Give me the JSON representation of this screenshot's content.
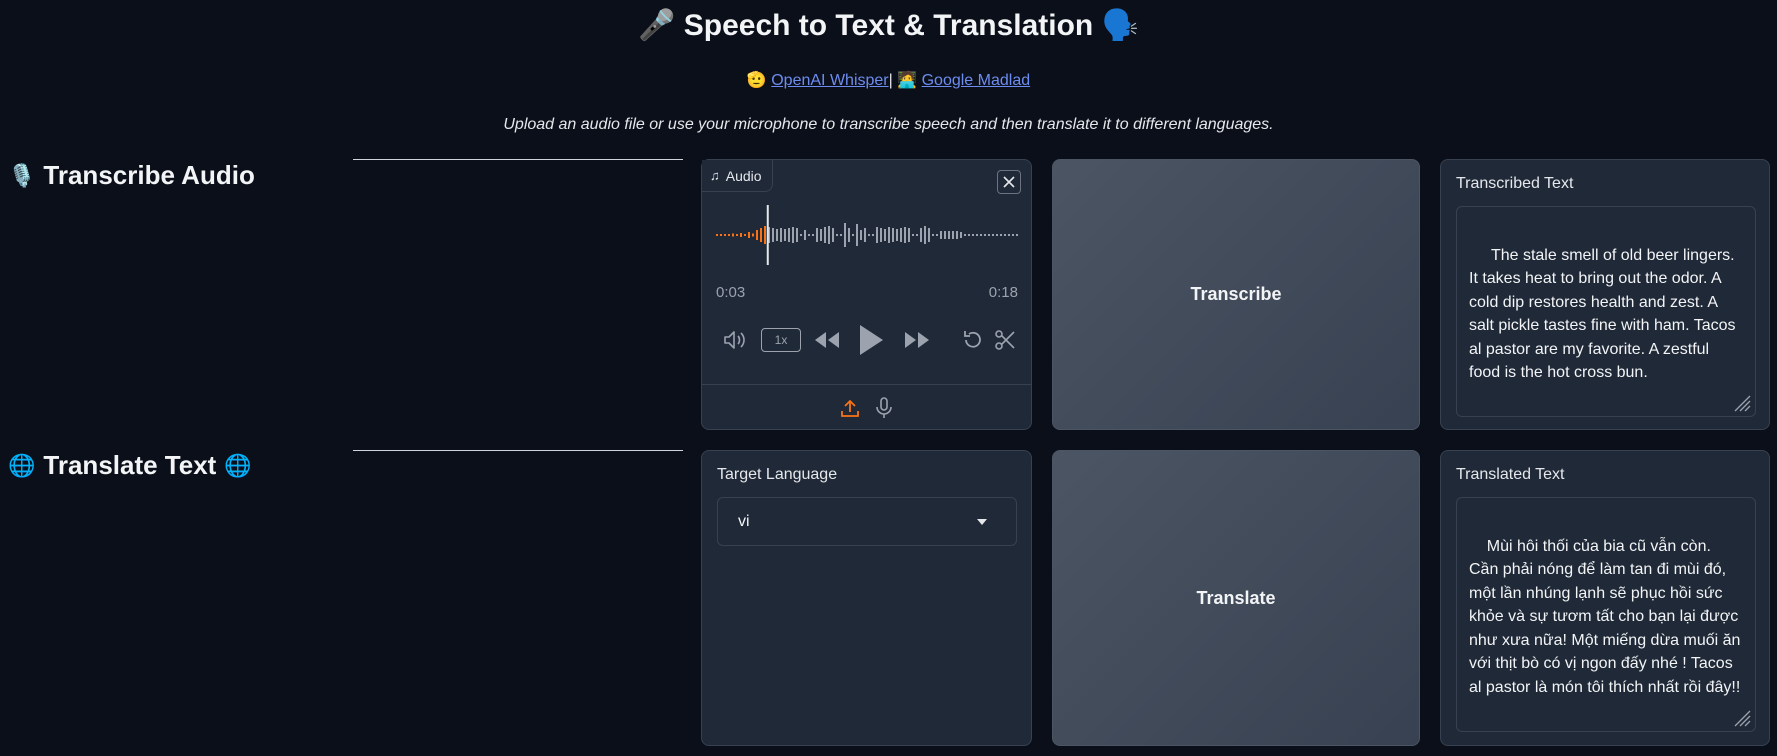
{
  "header": {
    "title": "Speech to Text & Translation",
    "title_icon_left": "microphone-icon",
    "title_icon_right": "speaking-head-icon",
    "links_sep": "|",
    "link_whisper": "OpenAI Whisper",
    "link_madlad": "Google Madlad",
    "subtitle": "Upload an audio file or use your microphone to transcribe speech and then translate it to different languages."
  },
  "transcribe_section": {
    "heading": "Transcribe Audio",
    "audio": {
      "tag_label": "Audio",
      "current_time": "0:03",
      "duration": "0:18",
      "speed": "1x",
      "progress": 0.167
    },
    "button_label": "Transcribe",
    "output_label": "Transcribed Text",
    "output_text": " The stale smell of old beer lingers. It takes heat to bring out the odor. A cold dip restores health and zest. A salt pickle tastes fine with ham. Tacos al pastor are my favorite. A zestful food is the hot cross bun."
  },
  "translate_section": {
    "heading": "Translate Text",
    "language_label": "Target Language",
    "language_value": "vi",
    "button_label": "Translate",
    "output_label": "Translated Text",
    "output_text": "Mùi hôi thối của bia cũ vẫn còn. Cần phải nóng để làm tan đi mùi đó, một lần nhúng lạnh sẽ phục hồi sức khỏe và sự tươm tất cho bạn lại được như xưa nữa! Một miếng dừa muối ăn với thịt bò có vị ngon đấy nhé ! Tacos al pastor là món tôi thích nhất rồi đây!!"
  },
  "colors": {
    "background": "#0b0f19",
    "panel": "#1f2937",
    "accent_orange": "#f97316",
    "link": "#6d8cf0"
  }
}
